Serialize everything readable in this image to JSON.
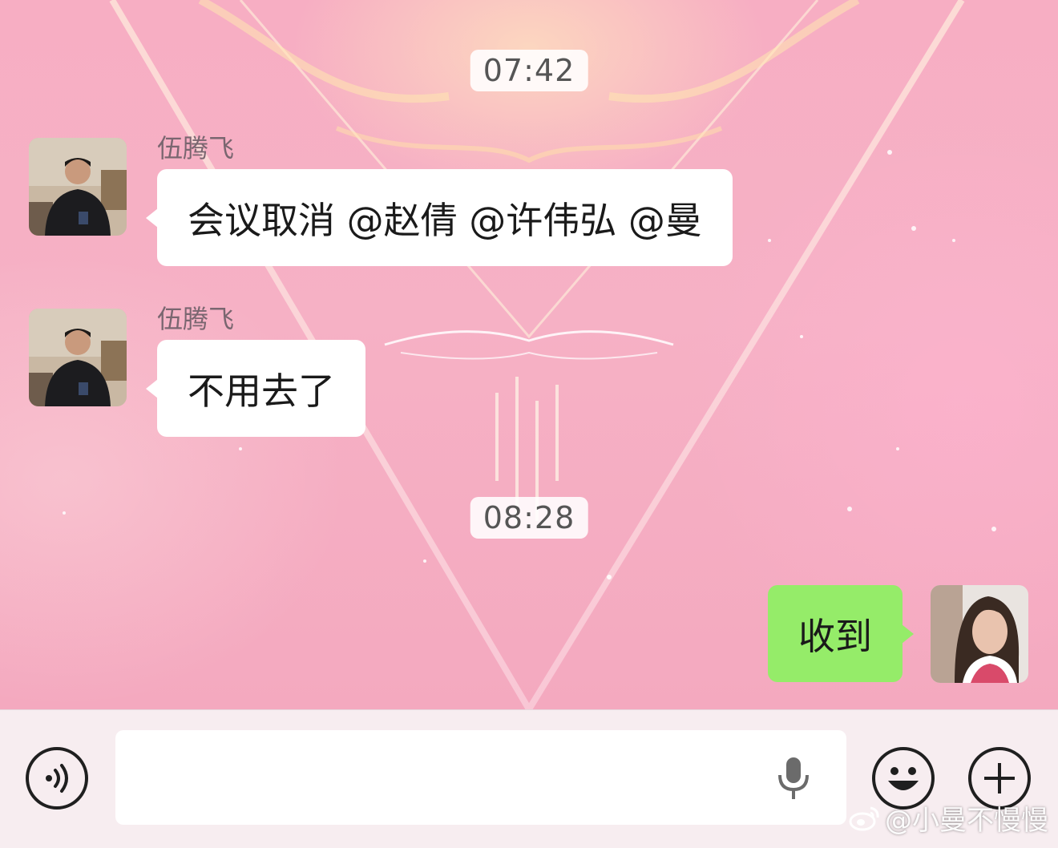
{
  "timestamps": [
    "07:42",
    "08:28"
  ],
  "messages": [
    {
      "sender": "伍腾飞",
      "text": "会议取消 @赵倩 @许伟弘 @曼"
    },
    {
      "sender": "伍腾飞",
      "text": "不用去了"
    },
    {
      "sender": "",
      "text": "收到"
    }
  ],
  "input_bar": {
    "voice_icon": "voice-toggle-icon",
    "mic_icon": "microphone-icon",
    "emoji_icon": "emoji-icon",
    "plus_icon": "plus-icon"
  },
  "watermark": "@小曼不慢慢",
  "colors": {
    "incoming_bubble": "#ffffff",
    "outgoing_bubble": "#95ec69",
    "background": "#f5b3c6"
  }
}
